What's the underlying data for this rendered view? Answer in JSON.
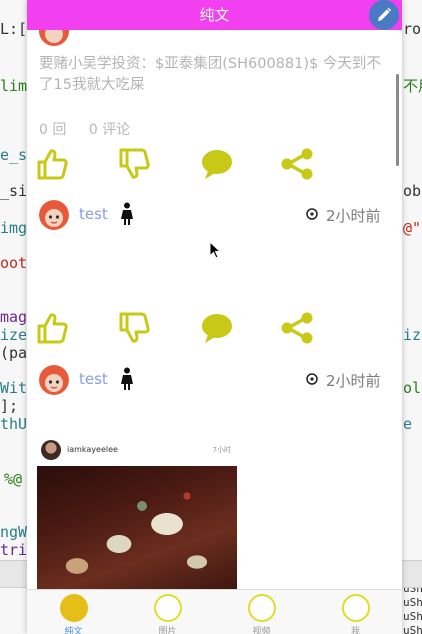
{
  "editor": {
    "lines": [
      {
        "text": "L:[N",
        "cls": "dark"
      },
      {
        "text": "lima",
        "cls": "green"
      },
      {
        "text": "e_s",
        "cls": "teal"
      },
      {
        "text": "_siz",
        "cls": "dark"
      },
      {
        "text": "img",
        "cls": "teal"
      },
      {
        "text": "oot",
        "cls": "red"
      },
      {
        "text": "mage",
        "cls": "purple"
      },
      {
        "text": "ize",
        "cls": "teal"
      },
      {
        "text": "(pat",
        "cls": "dark"
      },
      {
        "text": "With",
        "cls": "teal"
      },
      {
        "text": "];",
        "cls": "dark"
      },
      {
        "text": "thUI",
        "cls": "teal"
      },
      {
        "text": "%@",
        "cls": "green"
      },
      {
        "text": "ngW",
        "cls": "teal"
      },
      {
        "text": "trin",
        "cls": "purple"
      }
    ],
    "right_lines": [
      {
        "text": "ro",
        "cls": "dark"
      },
      {
        "text": "不用控",
        "cls": "green"
      },
      {
        "text": "obj",
        "cls": "dark"
      },
      {
        "text": "@\"",
        "cls": "red"
      },
      {
        "text": "ize",
        "cls": "teal"
      },
      {
        "text": "ol",
        "cls": "green"
      },
      {
        "text": "e",
        "cls": "teal"
      },
      {
        "text": "uSh",
        "cls": "dark"
      },
      {
        "text": "uSh",
        "cls": "dark"
      },
      {
        "text": "uSh",
        "cls": "dark"
      },
      {
        "text": "uSh",
        "cls": "dark"
      }
    ]
  },
  "nav": {
    "title": "纯文",
    "edit_icon": "pencil-icon",
    "bg_color": "#f23ff0"
  },
  "posts": [
    {
      "text": "要赌小吴学投资：$亚泰集团(SH600881)$ 今天到不了15我就大吃屎",
      "likes": "0 回",
      "comments": "0 评论"
    }
  ],
  "actions": {
    "like_icon": "thumbs-up-icon",
    "dislike_icon": "thumbs-down-icon",
    "comment_icon": "comment-icon",
    "share_icon": "share-icon",
    "color": "#c8c816"
  },
  "users": [
    {
      "name": "test",
      "time": "2小时前"
    },
    {
      "name": "test",
      "time": "2小时前"
    }
  ],
  "insta": {
    "user": "iamkayeelee",
    "time": "7小时"
  },
  "tabs": [
    {
      "label": "纯文",
      "active": true
    },
    {
      "label": "图片",
      "active": false
    },
    {
      "label": "视频",
      "active": false
    },
    {
      "label": "我",
      "active": false
    }
  ]
}
